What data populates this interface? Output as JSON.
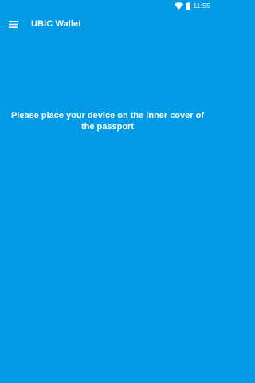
{
  "status_bar": {
    "time": "11:55",
    "wifi_icon": "wifi-icon",
    "battery_icon": "battery-icon"
  },
  "app_bar": {
    "menu_icon": "hamburger-menu-icon",
    "title": "UBIC Wallet"
  },
  "main": {
    "message": "Please place your device on the inner cover of the passport"
  },
  "colors": {
    "background": "#039BE5",
    "text": "#FFFFFF"
  }
}
